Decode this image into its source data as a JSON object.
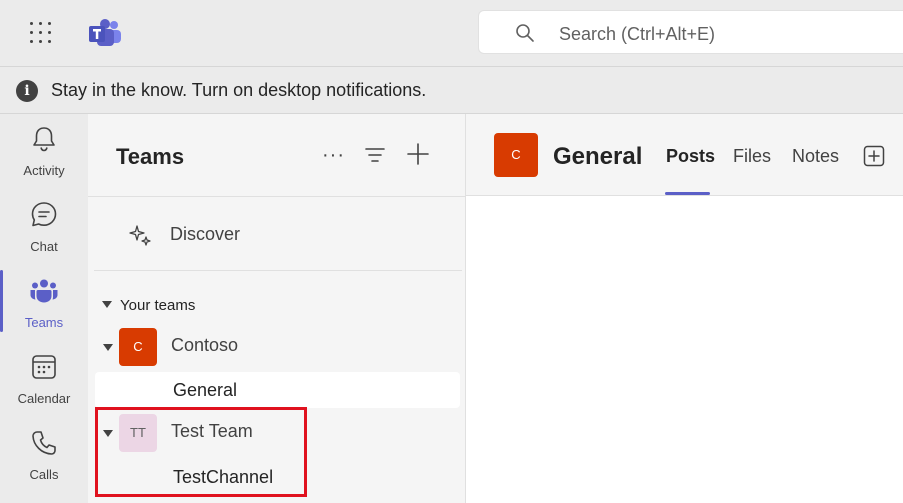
{
  "topbar": {
    "search_placeholder": "Search (Ctrl+Alt+E)"
  },
  "notification": {
    "text": "Stay in the know. Turn on desktop notifications."
  },
  "rail": {
    "items": [
      {
        "label": "Activity",
        "icon": "bell-icon"
      },
      {
        "label": "Chat",
        "icon": "chat-icon"
      },
      {
        "label": "Teams",
        "icon": "teams-icon",
        "active": true
      },
      {
        "label": "Calendar",
        "icon": "calendar-icon"
      },
      {
        "label": "Calls",
        "icon": "phone-icon"
      }
    ]
  },
  "teams_pane": {
    "title": "Teams",
    "more": "···",
    "discover_label": "Discover",
    "section_label": "Your teams",
    "teams": [
      {
        "name": "Contoso",
        "avatar_text": "C",
        "avatar_color": "#d83b01",
        "avatar_text_color": "#ffffff",
        "channels": [
          "General"
        ]
      },
      {
        "name": "Test Team",
        "avatar_text": "TT",
        "avatar_color": "#ecd6e5",
        "avatar_text_color": "#616161",
        "channels": [
          "TestChannel"
        ]
      }
    ]
  },
  "channel_view": {
    "avatar_text": "C",
    "title": "General",
    "tabs": [
      "Posts",
      "Files",
      "Notes"
    ],
    "active_tab": "Posts"
  },
  "colors": {
    "accent": "#5b5fc7",
    "highlight": "#e0121f"
  }
}
